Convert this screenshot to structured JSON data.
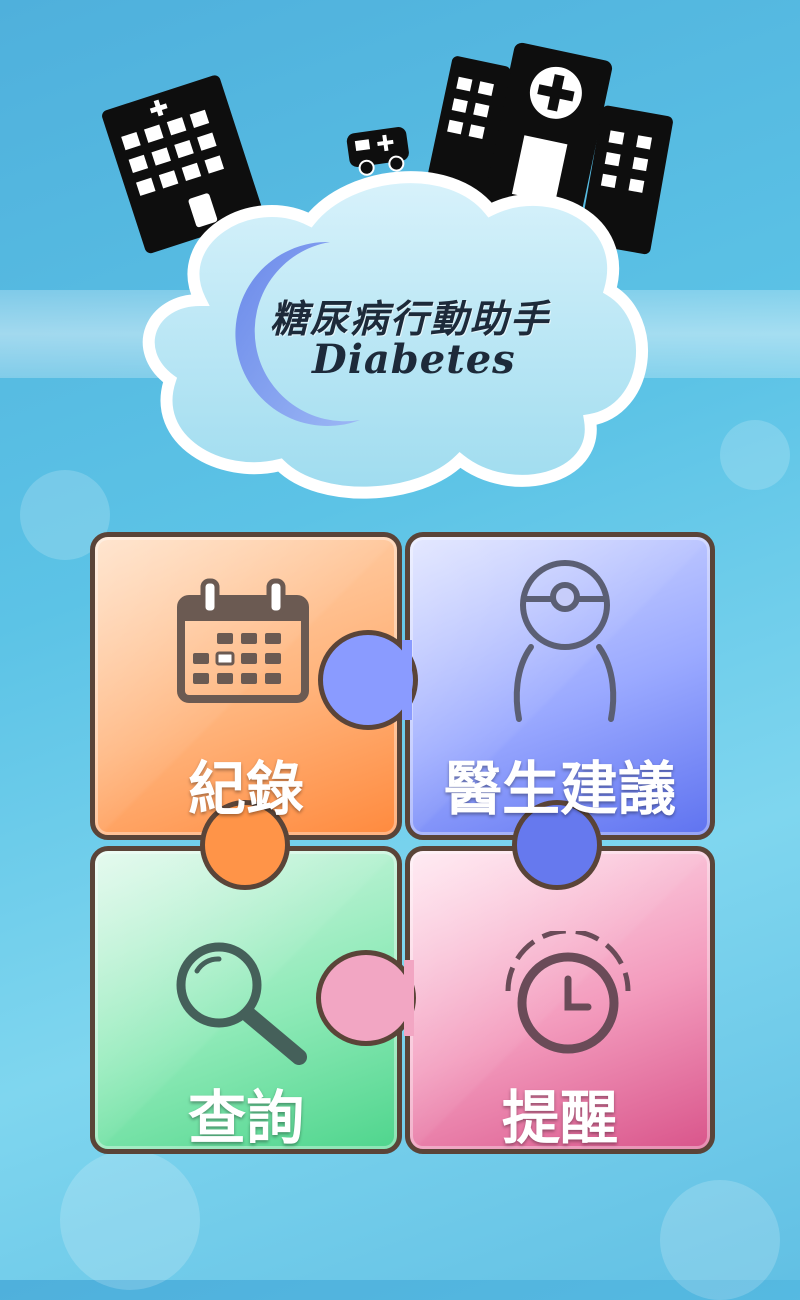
{
  "app": {
    "title_cn": "糖尿病行動助手",
    "title_en": "Diabetes"
  },
  "menu": {
    "record": {
      "label": "紀錄",
      "icon": "calendar-icon",
      "color": "#ff9448"
    },
    "doctor_advice": {
      "label": "醫生建議",
      "icon": "doctor-icon",
      "color": "#6679ee"
    },
    "search": {
      "label": "查詢",
      "icon": "magnifier-icon",
      "color": "#4fd58d"
    },
    "reminder": {
      "label": "提醒",
      "icon": "clock-icon",
      "color": "#d9558b"
    }
  },
  "colors": {
    "background": "#5cc3e6",
    "tile_border": "#5a4438"
  }
}
